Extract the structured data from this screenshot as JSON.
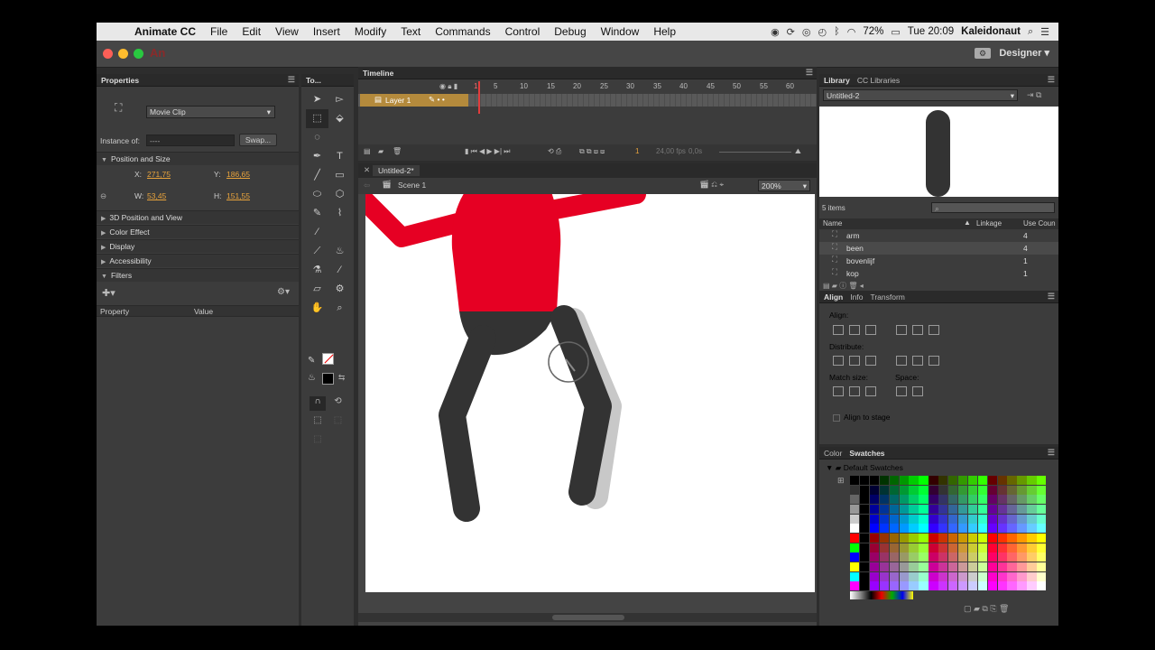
{
  "menubar": {
    "items": [
      "Animate CC",
      "File",
      "Edit",
      "View",
      "Insert",
      "Modify",
      "Text",
      "Commands",
      "Control",
      "Debug",
      "Window",
      "Help"
    ],
    "battery": "72%",
    "clock": "Tue 20:09",
    "user": "Kaleidonaut"
  },
  "appbar": {
    "logo": "An",
    "workspace": "Designer"
  },
  "properties": {
    "tab": "Properties",
    "symbol_type": "Movie Clip",
    "instance_label": "Instance of:",
    "instance_value": "----",
    "swap_label": "Swap...",
    "position_section": "Position and Size",
    "x_label": "X:",
    "x_value": "271,75",
    "y_label": "Y:",
    "y_value": "186,65",
    "w_label": "W:",
    "w_value": "53,45",
    "h_label": "H:",
    "h_value": "151,55",
    "sections": [
      "3D Position and View",
      "Color Effect",
      "Display",
      "Accessibility",
      "Filters"
    ],
    "col_property": "Property",
    "col_value": "Value"
  },
  "tools": {
    "tab": "To..."
  },
  "timeline": {
    "tab": "Timeline",
    "layer": "Layer 1",
    "ruler": [
      "1",
      "5",
      "10",
      "15",
      "20",
      "25",
      "30",
      "35",
      "40",
      "45",
      "50",
      "55",
      "60"
    ],
    "current_frame": "1",
    "fps": "24,00 fps",
    "time": "0,0s"
  },
  "document": {
    "tab": "Untitled-2*",
    "scene": "Scene 1",
    "zoom": "200%"
  },
  "library": {
    "tab_library": "Library",
    "tab_cc": "CC Libraries",
    "doc": "Untitled-2",
    "count": "5 items",
    "col_name": "Name",
    "col_linkage": "Linkage",
    "col_use": "Use Coun",
    "items": [
      {
        "name": "arm",
        "use": "4"
      },
      {
        "name": "been",
        "use": "4"
      },
      {
        "name": "bovenlijf",
        "use": "1"
      },
      {
        "name": "kop",
        "use": "1"
      }
    ]
  },
  "align": {
    "tabs": [
      "Align",
      "Info",
      "Transform"
    ],
    "align_label": "Align:",
    "distribute_label": "Distribute:",
    "match_label": "Match size:",
    "space_label": "Space:",
    "stage_label": "Align to stage"
  },
  "swatches": {
    "tabs": [
      "Color",
      "Swatches"
    ],
    "group": "Default Swatches"
  },
  "colors": {
    "body_red": "#e60023",
    "limb_dark": "#333333"
  }
}
